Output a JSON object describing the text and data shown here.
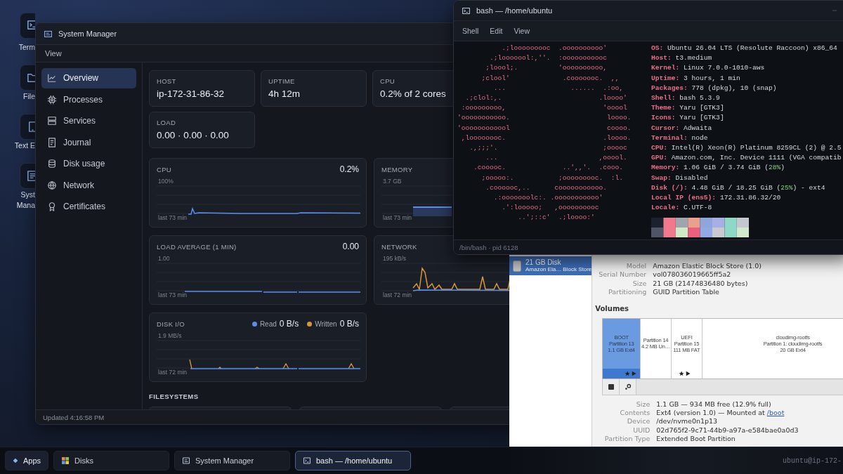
{
  "desktop_icons": [
    {
      "lines": [
        "Term"
      ]
    },
    {
      "lines": [
        "File"
      ]
    },
    {
      "lines": [
        "Text E"
      ]
    },
    {
      "lines": [
        "Syst",
        "Mana"
      ]
    }
  ],
  "system_manager": {
    "title": "System Manager",
    "menu": [
      "View"
    ],
    "sidebar": [
      {
        "label": "Overview",
        "selected": true
      },
      {
        "label": "Processes",
        "selected": false
      },
      {
        "label": "Services",
        "selected": false
      },
      {
        "label": "Journal",
        "selected": false
      },
      {
        "label": "Disk usage",
        "selected": false
      },
      {
        "label": "Network",
        "selected": false
      },
      {
        "label": "Certificates",
        "selected": false
      }
    ],
    "stats": [
      {
        "label": "HOST",
        "value": "ip-172-31-86-32"
      },
      {
        "label": "UPTIME",
        "value": "4h 12m"
      },
      {
        "label": "CPU",
        "value": "0.2% of 2 cores"
      },
      {
        "label": "LOAD",
        "value": "0.00 · 0.00 · 0.00"
      }
    ],
    "charts": [
      {
        "kind": "cpu",
        "title": "CPU",
        "reading": "0.2%",
        "max_label": "100%",
        "span_label": "last 73 min"
      },
      {
        "kind": "memory",
        "title": "MEMORY",
        "max_label": "3.7 GB",
        "span_label": "last 73 min"
      },
      {
        "kind": "load",
        "title": "LOAD AVERAGE (1 MIN)",
        "reading": "0.00",
        "max_label": "1.00",
        "span_label": "last 73 min"
      },
      {
        "kind": "network",
        "title": "NETWORK",
        "max_label": "195 kB/s",
        "span_label": "last 72 min"
      },
      {
        "kind": "disk",
        "title": "DISK I/O",
        "max_label": "1.9 MB/s",
        "span_label": "last 72 min",
        "legend": [
          {
            "label": "Read",
            "value": "0 B/s",
            "color": "#5b8def"
          },
          {
            "label": "Written",
            "value": "0 B/s",
            "color": "#d9973a"
          }
        ]
      }
    ],
    "filesystems_heading": "FILESYSTEMS",
    "status": "Updated 4:16:58 PM"
  },
  "terminal": {
    "title": "bash — /home/ubuntu",
    "menu": [
      "Shell",
      "Edit",
      "View"
    ],
    "ascii_art": [
      "           .;looooooooc  .oooooooooo'",
      "        .;looooool:,''.  :ooooooooooc",
      "       ;loool;.          'oooooooooo,",
      "      ;clool'             .cooooooc.  ,,",
      "         ...                ......  .:oo,",
      "  .;clol:,.                        .loooo'",
      " :ooooooooo,                        'ooool",
      "'ooooooooooo.                        loooo.",
      "'oooooooooool                        coooo.",
      " ,loooooooc.                        .loooo.",
      "   .,;;;'.                          ;ooooc",
      "       ...                         ,ooool.",
      "    .cooooc.              ..',,'.  .cooo.",
      "      ;ooooo:.           ;ooooooooc.  :l.",
      "       .coooooc,..      cooooooooooo.",
      "         .:ooooooolc:. .ooooooooooo'",
      "           .':looooo;   ,oooooooooc",
      "               ..';::c'  .;loooo:'"
    ],
    "info": [
      {
        "key": "OS:",
        "value": "Ubuntu 26.04 LTS (Resolute Raccoon) x86_64"
      },
      {
        "key": "Host:",
        "value": "t3.medium"
      },
      {
        "key": "Kernel:",
        "value": "Linux 7.0.0-1010-aws"
      },
      {
        "key": "Uptime:",
        "value": "3 hours, 1 min"
      },
      {
        "key": "Packages:",
        "value": "778 (dpkg), 10 (snap)"
      },
      {
        "key": "Shell:",
        "value": "bash 5.3.9"
      },
      {
        "key": "Theme:",
        "value": "Yaru [GTK3]"
      },
      {
        "key": "Icons:",
        "value": "Yaru [GTK3]"
      },
      {
        "key": "Cursor:",
        "value": "Adwaita"
      },
      {
        "key": "Terminal:",
        "value": "node"
      },
      {
        "key": "CPU:",
        "value": "Intel(R) Xeon(R) Platinum 8259CL (2) @ 2.5"
      },
      {
        "key": "GPU:",
        "value": "Amazon.com, Inc. Device 1111 (VGA compatib"
      },
      {
        "key": "Memory:",
        "value": "1.06 GiB / 3.74 GiB (",
        "highlight": "28%",
        "rest": ")"
      },
      {
        "key": "Swap:",
        "value": "Disabled"
      },
      {
        "key": "Disk (/):",
        "value": "4.48 GiB / 18.25 GiB (",
        "highlight": "25%",
        "rest": ") - ext4"
      },
      {
        "key": "Local IP (ens5):",
        "value": "172.31.86.32/20"
      },
      {
        "key": "Locale:",
        "value": "C.UTF-8"
      }
    ],
    "status": "/bin/bash · pid 6128"
  },
  "disks": {
    "drives": [
      {
        "name": "21 GB Disk",
        "detail": "Amazon Ela… Block Store",
        "selected": true
      }
    ],
    "drive_details": [
      {
        "label": "Model",
        "value": "Amazon Elastic Block Store (1.0)"
      },
      {
        "label": "Serial Number",
        "value": "vol078036019665ff5a2"
      },
      {
        "label": "Size",
        "value": "21 GB (21474836480 bytes)"
      },
      {
        "label": "Partitioning",
        "value": "GUID Partition Table"
      }
    ],
    "volumes_heading": "Volumes",
    "partitions": [
      {
        "lines": [
          "BOOT",
          "Partition 13",
          "1.1 GB Ext4"
        ],
        "selected": true,
        "flag_icons": true
      },
      {
        "lines": [
          "Partition 14",
          "4.2 MB Un…"
        ],
        "selected": false,
        "flag_icons": false
      },
      {
        "lines": [
          "UEFI",
          "Partition 15",
          "111 MB FAT"
        ],
        "selected": false,
        "flag_icons": true
      },
      {
        "lines": [
          "cloudimg-rootfs",
          "Partition 1: cloudimg-rootfs",
          "20 GB Ext4"
        ],
        "selected": false,
        "flag_icons": false
      }
    ],
    "partition_details": [
      {
        "label": "Size",
        "value": "1.1 GB — 934 MB free (12.9% full)"
      },
      {
        "label": "Contents",
        "value": "Ext4 (version 1.0) — Mounted at ",
        "link": "/boot"
      },
      {
        "label": "Device",
        "value": "/dev/nvme0n1p13"
      },
      {
        "label": "UUID",
        "value": "02d765f2-9c71-44b9-a97a-e584bae0a0d3"
      },
      {
        "label": "Partition Type",
        "value": "Extended Boot Partition"
      }
    ]
  },
  "taskbar": {
    "apps_label": "Apps",
    "windows": [
      {
        "label": "Disks",
        "selected": false
      },
      {
        "label": "System Manager",
        "selected": false
      },
      {
        "label": "bash — /home/ubuntu",
        "selected": true
      }
    ],
    "user_host": "ubuntu@ip-172-"
  }
}
